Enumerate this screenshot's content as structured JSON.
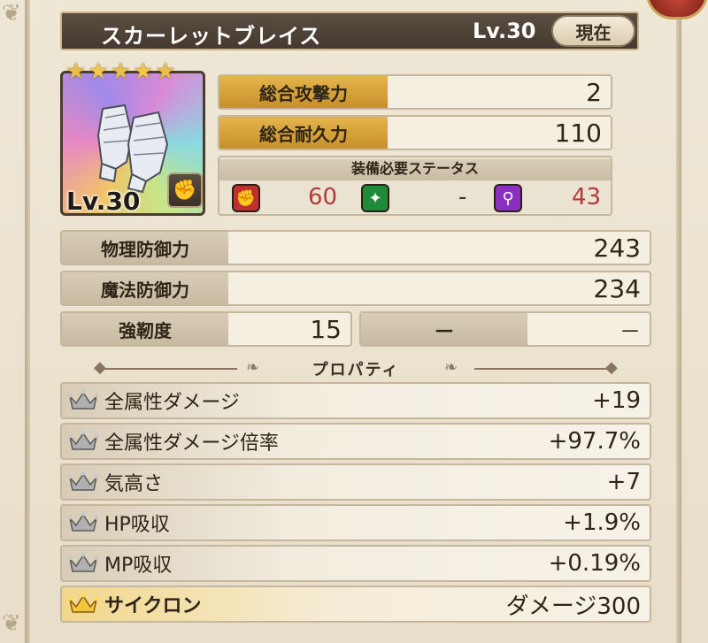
{
  "title": {
    "name": "スカーレットブレイス",
    "level": "Lv.30",
    "current_button": "現在"
  },
  "item": {
    "stars": 5,
    "level": "Lv.30",
    "icon": "gauntlets-icon",
    "type_icon": "gauntlet-type-icon"
  },
  "stats": {
    "attack_label": "総合攻撃力",
    "attack_value": "2",
    "durability_label": "総合耐久力",
    "durability_value": "110"
  },
  "requirements": {
    "title": "装備必要ステータス",
    "items": [
      {
        "icon": "strength-icon",
        "color": "#c0302e",
        "value": "60"
      },
      {
        "icon": "dexterity-icon",
        "color": "#1f8a3a",
        "value": "-"
      },
      {
        "icon": "magic-icon",
        "color": "#8a2fc0",
        "value": "43"
      }
    ]
  },
  "defense": {
    "physical_label": "物理防御力",
    "physical_value": "243",
    "magic_label": "魔法防御力",
    "magic_value": "234",
    "toughness_label": "強靭度",
    "toughness_value": "15",
    "extra_label": "－",
    "extra_value": "－"
  },
  "properties": {
    "title": "プロパティ",
    "items": [
      {
        "name": "全属性ダメージ",
        "value": "+19",
        "crown": "silver"
      },
      {
        "name": "全属性ダメージ倍率",
        "value": "+97.7%",
        "crown": "silver"
      },
      {
        "name": "気高さ",
        "value": "+7",
        "crown": "silver"
      },
      {
        "name": "HP吸収",
        "value": "+1.9%",
        "crown": "silver"
      },
      {
        "name": "MP吸収",
        "value": "+0.19%",
        "crown": "silver"
      },
      {
        "name": "サイクロン",
        "value": "ダメージ300",
        "crown": "gold"
      }
    ]
  },
  "colors": {
    "gold_label": "#d9a33a",
    "accent_red": "#b23a3a",
    "frame": "#e9e0cd"
  }
}
